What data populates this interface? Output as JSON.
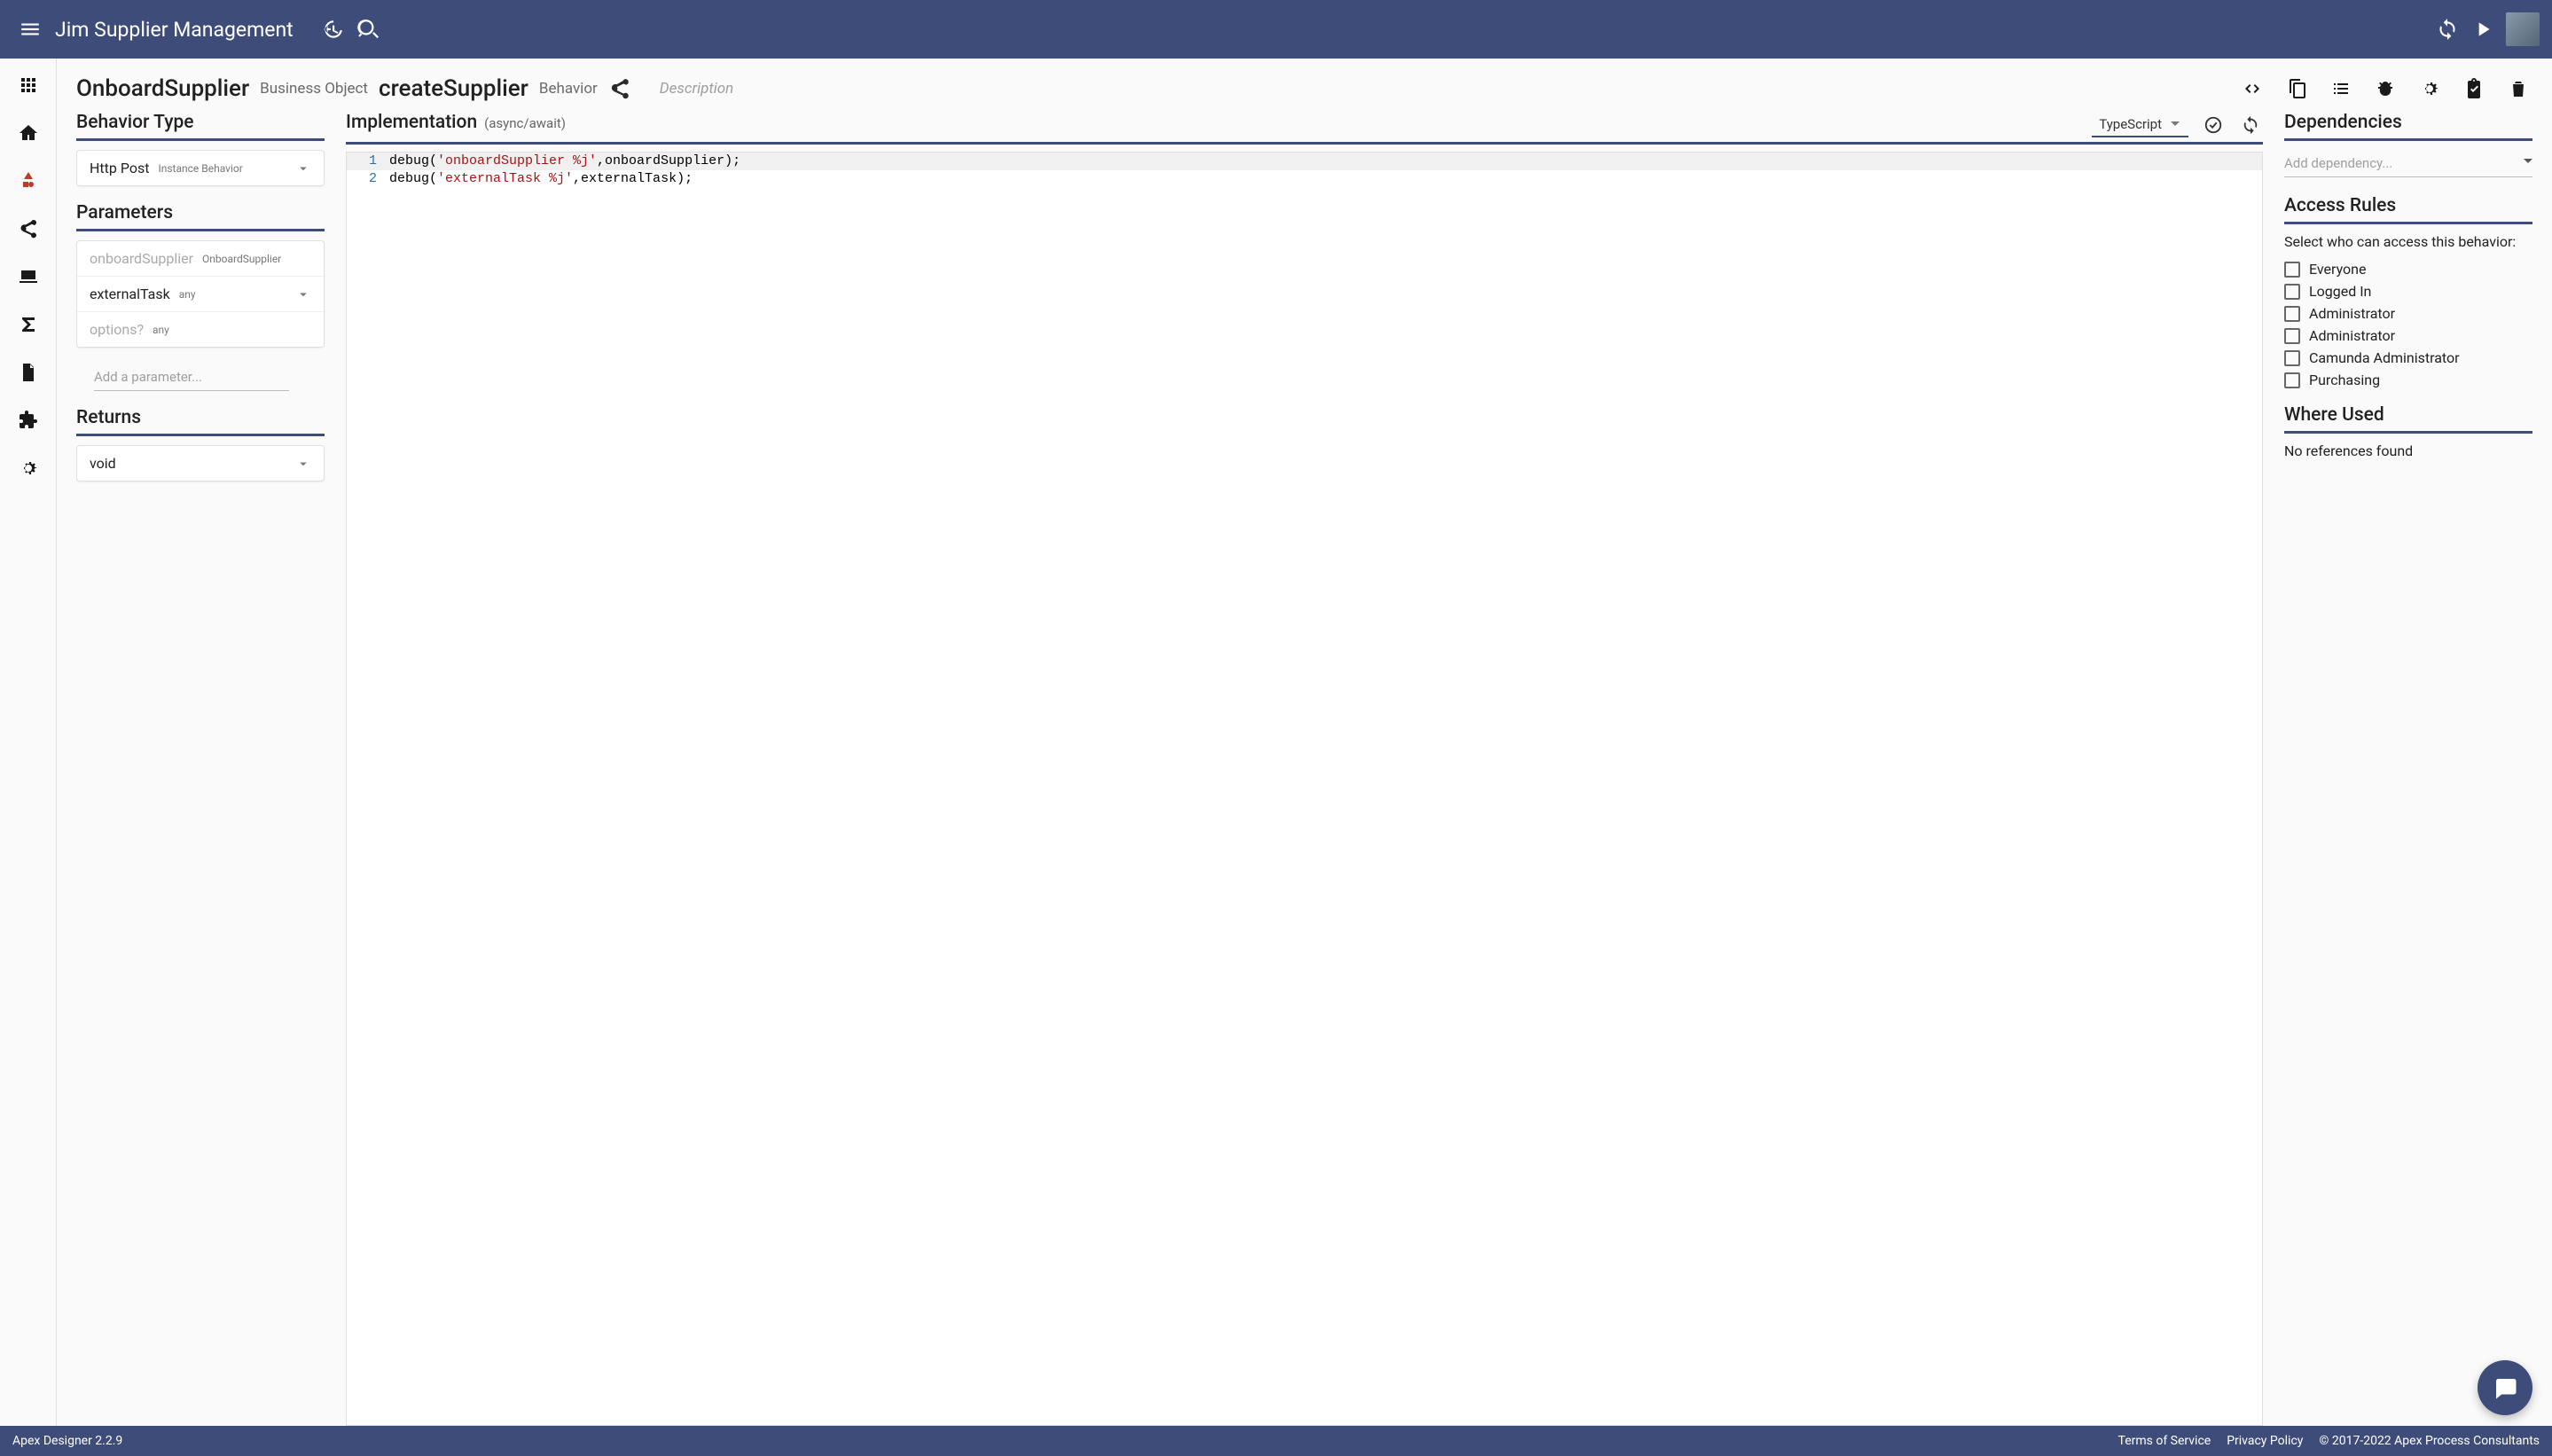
{
  "topbar": {
    "title": "Jim Supplier Management"
  },
  "page": {
    "businessObject": "OnboardSupplier",
    "boSub": "Business Object",
    "behavior": "createSupplier",
    "behSub": "Behavior",
    "descriptionPlaceholder": "Description"
  },
  "behaviorType": {
    "title": "Behavior Type",
    "value": "Http Post",
    "meta": "Instance Behavior"
  },
  "parameters": {
    "title": "Parameters",
    "items": [
      {
        "name": "onboardSupplier",
        "type": "OnboardSupplier",
        "faded": true,
        "expandable": false
      },
      {
        "name": "externalTask",
        "type": "any",
        "faded": false,
        "expandable": true
      },
      {
        "name": "options?",
        "type": "any",
        "faded": true,
        "expandable": false
      }
    ],
    "addPlaceholder": "Add a parameter..."
  },
  "returns": {
    "title": "Returns",
    "value": "void"
  },
  "implementation": {
    "title": "Implementation",
    "mode": "(async/await)",
    "language": "TypeScript",
    "lines": [
      {
        "n": 1,
        "pre": "debug(",
        "str": "'onboardSupplier %j'",
        "post": ",onboardSupplier);"
      },
      {
        "n": 2,
        "pre": "debug(",
        "str": "'externalTask %j'",
        "post": ",externalTask);"
      }
    ]
  },
  "dependencies": {
    "title": "Dependencies",
    "placeholder": "Add dependency..."
  },
  "accessRules": {
    "title": "Access Rules",
    "help": "Select who can access this behavior:",
    "options": [
      "Everyone",
      "Logged In",
      "Administrator",
      "Administrator",
      "Camunda Administrator",
      "Purchasing"
    ]
  },
  "whereUsed": {
    "title": "Where Used",
    "empty": "No references found"
  },
  "footer": {
    "product": "Apex Designer 2.2.9",
    "tos": "Terms of Service",
    "privacy": "Privacy Policy",
    "copyright": "© 2017-2022 Apex Process Consultants"
  }
}
